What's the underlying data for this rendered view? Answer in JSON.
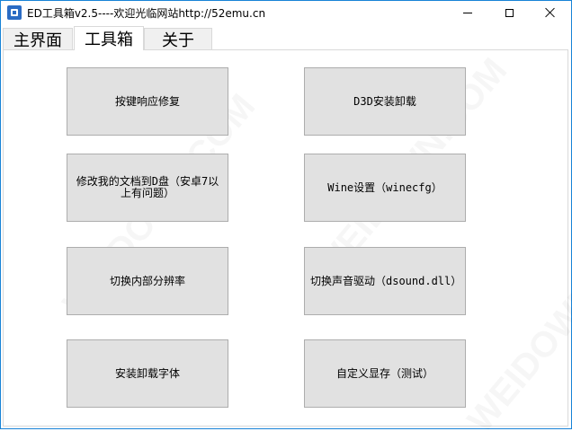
{
  "window": {
    "title": "ED工具箱v2.5----欢迎光临网站http://52emu.cn",
    "controls": {
      "minimize": "minimize",
      "maximize": "maximize",
      "close": "close"
    }
  },
  "tabs": [
    {
      "label": "主界面",
      "selected": false
    },
    {
      "label": "工具箱",
      "selected": true
    },
    {
      "label": "关于",
      "selected": false
    }
  ],
  "tools": {
    "key_response_fix": "按键响应修复",
    "d3d_install": "D3D安装卸载",
    "move_documents": "修改我的文档到D盘（安卓7以上有问题）",
    "wine_settings": "Wine设置（winecfg）",
    "switch_resolution": "切换内部分辨率",
    "switch_sound": "切换声音驱动（dsound.dll）",
    "font_install": "安装卸载字体",
    "custom_vram": "自定义显存（测试）"
  },
  "watermark": "WEIDOWN.COM"
}
